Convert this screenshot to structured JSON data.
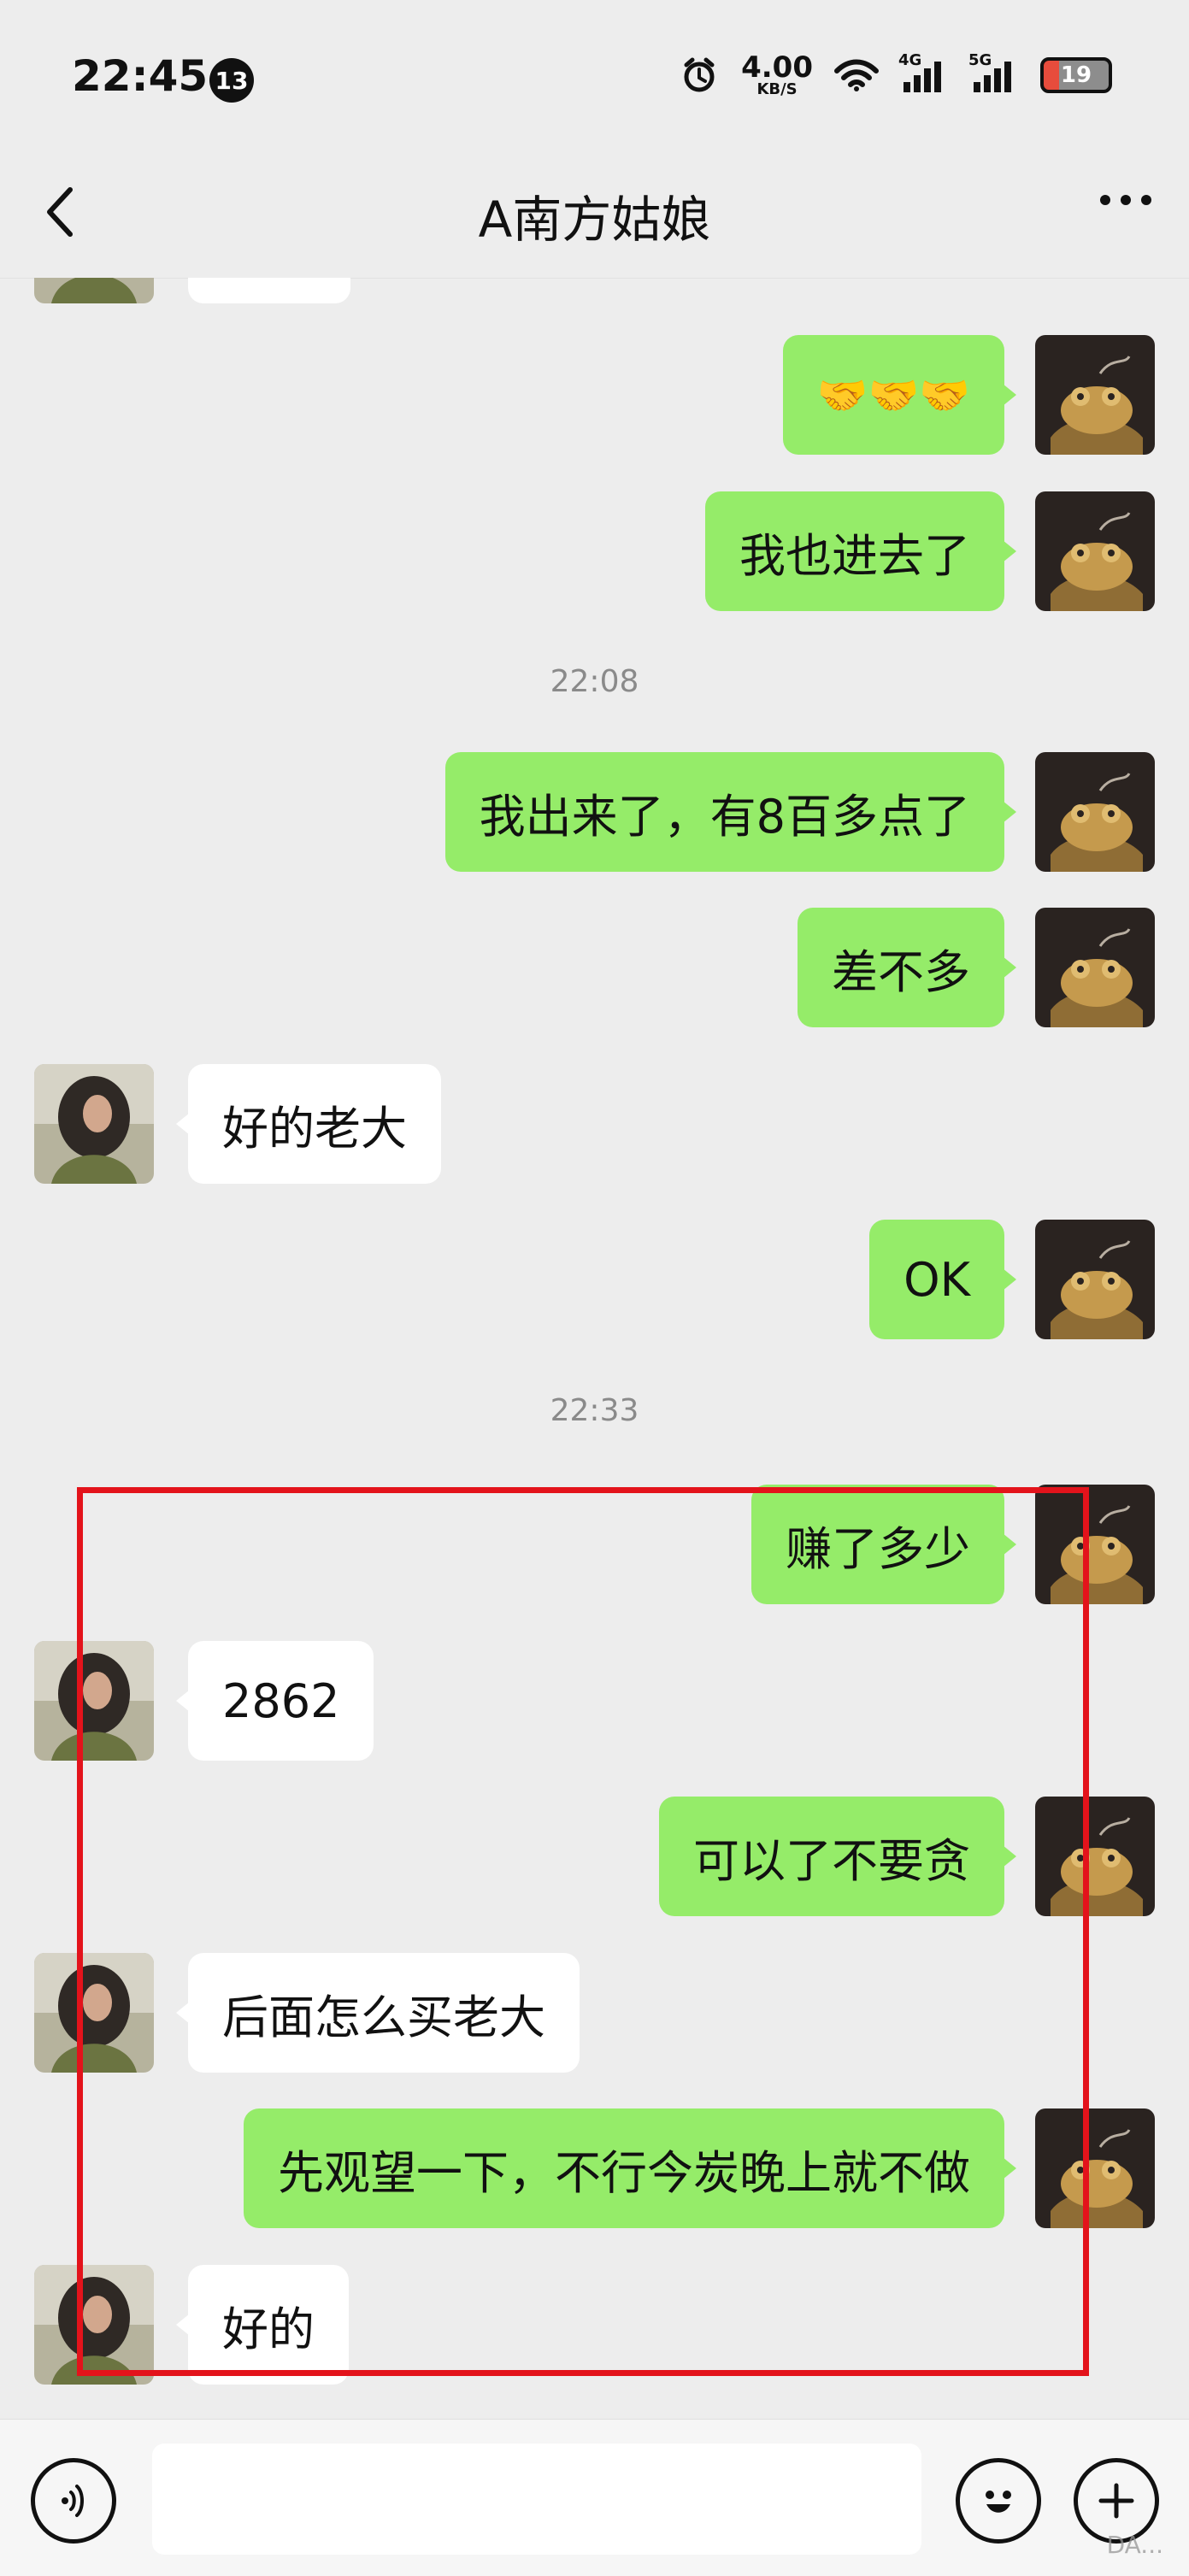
{
  "status_bar": {
    "time": "22:45",
    "notification_count": "13",
    "speed_value": "4.00",
    "speed_unit": "KB/S",
    "network_1": "4G",
    "network_2": "5G",
    "battery": "19"
  },
  "header": {
    "title": "A南方姑娘"
  },
  "messages": [
    {
      "side": "left",
      "text": ""
    },
    {
      "side": "right",
      "text": "🤝🤝🤝"
    },
    {
      "side": "right",
      "text": "我也进去了"
    },
    {
      "timestamp": "22:08"
    },
    {
      "side": "right",
      "text": "我出来了，有8百多点了"
    },
    {
      "side": "right",
      "text": "差不多"
    },
    {
      "side": "left",
      "text": "好的老大"
    },
    {
      "side": "right",
      "text": "OK"
    },
    {
      "timestamp": "22:33"
    },
    {
      "side": "right",
      "text": "赚了多少"
    },
    {
      "side": "left",
      "text": "2862"
    },
    {
      "side": "right",
      "text": "可以了不要贪"
    },
    {
      "side": "left",
      "text": "后面怎么买老大"
    },
    {
      "side": "right",
      "text": "先观望一下，不行今炭晚上就不做"
    },
    {
      "side": "left",
      "text": "好的"
    }
  ],
  "input": {
    "placeholder": ""
  },
  "watermark": "DA..."
}
